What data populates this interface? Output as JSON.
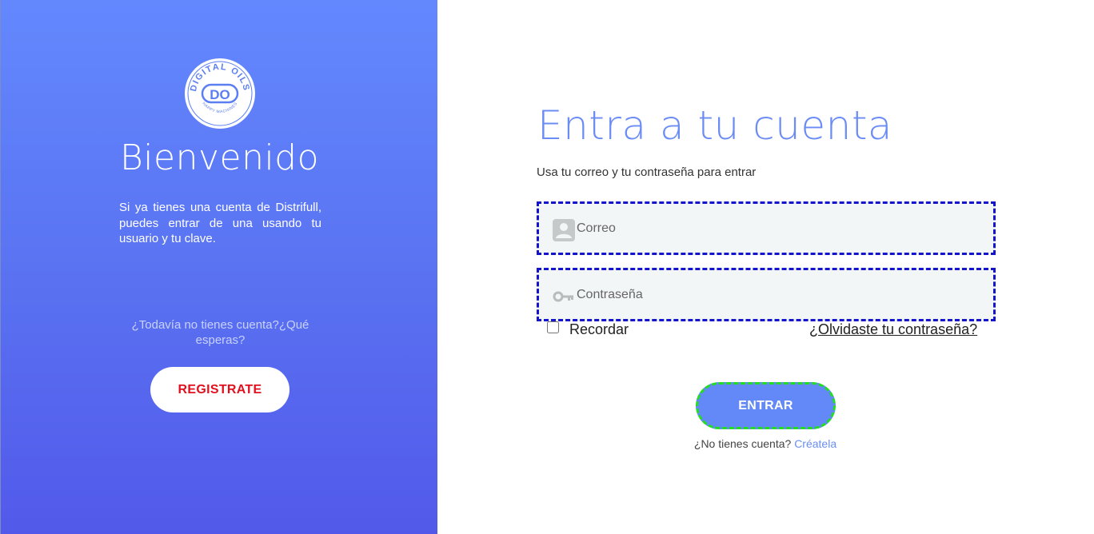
{
  "left": {
    "logo": {
      "arc_top": "DIGITAL OILS",
      "monogram": "DO",
      "arc_bottom": "HAPPY MACHINES"
    },
    "welcome": "Bienvenido",
    "intro": "Si ya tienes una cuenta de Distrifull, puedes entrar de una usando tu usuario y tu clave.",
    "question": "¿Todavía no tienes cuenta?¿Qué esperas?",
    "register_label": "REGISTRATE"
  },
  "right": {
    "title": "Entra a tu cuenta",
    "subtitle": "Usa tu correo y tu contraseña para entrar",
    "email_placeholder": "Correo",
    "password_placeholder": "Contraseña",
    "remember_label": "Recordar",
    "forgot_label": "¿Olvidaste tu contraseña?",
    "enter_label": "ENTRAR",
    "no_account_text": "¿No tienes cuenta?",
    "create_link": "Créatela"
  },
  "colors": {
    "brand_blue": "#6388f7",
    "register_red": "#e0101e",
    "link_blue": "#6b8ff0"
  },
  "icons": [
    "user-icon",
    "key-icon",
    "logo"
  ]
}
